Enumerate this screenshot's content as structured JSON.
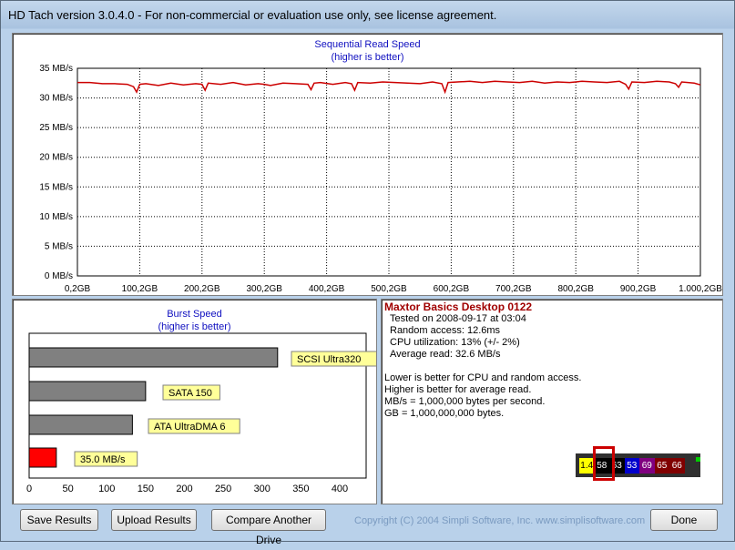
{
  "window": {
    "title": "HD Tach version 3.0.4.0  - For non-commercial or evaluation use only, see license agreement."
  },
  "seq_chart": {
    "title": "Sequential Read Speed",
    "subtitle": "(higher is better)",
    "line_color": "#cc0000",
    "chart_data": {
      "type": "line",
      "x_unit": "GB",
      "xlim": [
        0,
        1000
      ],
      "ylim": [
        0,
        35
      ],
      "y_ticks": [
        "35 MB/s",
        "30 MB/s",
        "25 MB/s",
        "20 MB/s",
        "15 MB/s",
        "10 MB/s",
        "5 MB/s",
        "0 MB/s"
      ],
      "x_ticks": [
        "0,2GB",
        "100,2GB",
        "200,2GB",
        "300,2GB",
        "400,2GB",
        "500,2GB",
        "600,2GB",
        "700,2GB",
        "800,2GB",
        "900,2GB",
        "1.000,2GB"
      ],
      "x": [
        0,
        20,
        40,
        60,
        80,
        90,
        95,
        100,
        110,
        130,
        150,
        170,
        190,
        200,
        205,
        210,
        230,
        250,
        270,
        290,
        300,
        310,
        330,
        350,
        370,
        375,
        380,
        390,
        410,
        430,
        440,
        445,
        450,
        470,
        490,
        510,
        530,
        550,
        570,
        585,
        590,
        595,
        610,
        630,
        650,
        670,
        690,
        710,
        730,
        750,
        770,
        790,
        810,
        830,
        850,
        870,
        880,
        885,
        890,
        910,
        930,
        950,
        960,
        965,
        970,
        990,
        1000
      ],
      "y": [
        32.6,
        32.6,
        32.4,
        32.4,
        32.3,
        31.9,
        31.0,
        32.3,
        32.4,
        32.1,
        32.5,
        32.2,
        32.4,
        32.3,
        31.3,
        32.5,
        32.3,
        32.6,
        32.2,
        32.4,
        32.3,
        32.1,
        32.5,
        32.4,
        32.3,
        31.4,
        32.5,
        32.6,
        32.3,
        32.6,
        32.4,
        31.3,
        32.6,
        32.5,
        32.7,
        32.6,
        32.5,
        32.4,
        32.7,
        32.4,
        31.0,
        32.6,
        32.7,
        32.8,
        32.6,
        32.8,
        32.7,
        32.6,
        32.8,
        32.5,
        32.7,
        32.6,
        32.8,
        32.7,
        32.6,
        32.8,
        32.3,
        31.5,
        32.7,
        32.6,
        32.8,
        32.7,
        32.4,
        31.8,
        32.7,
        32.5,
        32.2
      ]
    }
  },
  "burst_chart": {
    "title": "Burst Speed",
    "subtitle": "(higher is better)",
    "chart_data": {
      "type": "bar",
      "orientation": "horizontal",
      "categories": [
        "SCSI Ultra320",
        "SATA 150",
        "ATA UltraDMA 6",
        "35.0 MB/s"
      ],
      "values": [
        320,
        150,
        133,
        35
      ],
      "colors": [
        "#808080",
        "#808080",
        "#808080",
        "#ff0000"
      ],
      "xlim": [
        0,
        440
      ],
      "x_ticks": [
        "0",
        "50",
        "100",
        "150",
        "200",
        "250",
        "300",
        "350",
        "400"
      ]
    }
  },
  "info": {
    "drive": "Maxtor Basics Desktop 0122",
    "tested": "Tested on 2008-09-17 at 03:04",
    "random": "Random access: 12.6ms",
    "cpu": "CPU utilization: 13% (+/- 2%)",
    "avg": "Average read: 32.6 MB/s",
    "note1": "Lower is better for CPU and random access.",
    "note2": "Higher is better for average read.",
    "note3": "MB/s = 1,000,000 bytes per second.",
    "note4": "GB = 1,000,000,000 bytes."
  },
  "strip": {
    "cells": [
      {
        "text": "1.4",
        "bg": "#ffff00",
        "fg": "#000000"
      },
      {
        "text": "58",
        "bg": "#000000",
        "fg": "#ffffff"
      },
      {
        "text": "63",
        "bg": "#000000",
        "fg": "#ffffff"
      },
      {
        "text": "53",
        "bg": "#0000cc",
        "fg": "#ffffff"
      },
      {
        "text": "69",
        "bg": "#800080",
        "fg": "#ffffff"
      },
      {
        "text": "65",
        "bg": "#800000",
        "fg": "#ffffff"
      },
      {
        "text": "66",
        "bg": "#800000",
        "fg": "#ffffff"
      }
    ],
    "highlight_color": "#cc0000"
  },
  "buttons": {
    "save": "Save Results",
    "upload": "Upload Results",
    "compare": "Compare Another Drive",
    "done": "Done"
  },
  "copyright": "Copyright (C) 2004 Simpli Software, Inc. www.simplisoftware.com"
}
